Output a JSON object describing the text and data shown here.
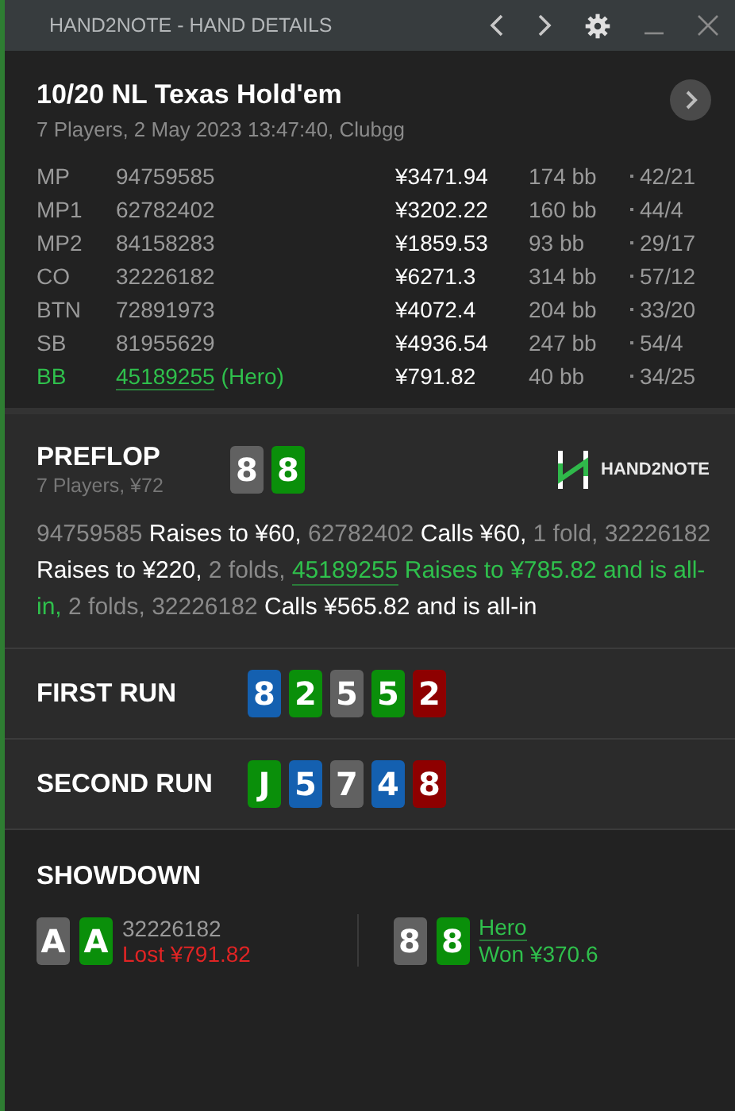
{
  "window": {
    "title": "HAND2NOTE - HAND DETAILS"
  },
  "header": {
    "title": "10/20 NL Texas Hold'em",
    "subtitle": "7 Players, 2 May 2023 13:47:40, Clubgg"
  },
  "players": [
    {
      "position": "MP",
      "name": "94759585",
      "hero": false,
      "stack": "¥3471.94",
      "bb": "174 bb",
      "stats": "42/21"
    },
    {
      "position": "MP1",
      "name": "62782402",
      "hero": false,
      "stack": "¥3202.22",
      "bb": "160 bb",
      "stats": "44/4"
    },
    {
      "position": "MP2",
      "name": "84158283",
      "hero": false,
      "stack": "¥1859.53",
      "bb": "93 bb",
      "stats": "29/17"
    },
    {
      "position": "CO",
      "name": "32226182",
      "hero": false,
      "stack": "¥6271.3",
      "bb": "314 bb",
      "stats": "57/12"
    },
    {
      "position": "BTN",
      "name": "72891973",
      "hero": false,
      "stack": "¥4072.4",
      "bb": "204 bb",
      "stats": "33/20"
    },
    {
      "position": "SB",
      "name": "81955629",
      "hero": false,
      "stack": "¥4936.54",
      "bb": "247 bb",
      "stats": "54/4"
    },
    {
      "position": "BB",
      "name": "45189255",
      "hero": true,
      "hero_tag": "(Hero)",
      "stack": "¥791.82",
      "bb": "40 bb",
      "stats": "34/25"
    }
  ],
  "preflop": {
    "title": "PREFLOP",
    "subtitle": "7 Players, ¥72",
    "logo": "HAND2NOTE",
    "cards": [
      {
        "rank": "8",
        "color": "#616161"
      },
      {
        "rank": "8",
        "color": "#0a8f0a"
      }
    ],
    "actions": [
      {
        "kind": "muted",
        "text": "94759585"
      },
      {
        "kind": "bright",
        "text": "Raises to ¥60,"
      },
      {
        "kind": "muted",
        "text": "62782402"
      },
      {
        "kind": "bright",
        "text": "Calls ¥60,"
      },
      {
        "kind": "muted",
        "text": "1 fold,"
      },
      {
        "kind": "muted",
        "text": "32226182"
      },
      {
        "kind": "bright",
        "text": "Raises to ¥220,"
      },
      {
        "kind": "muted",
        "text": "2 folds,"
      },
      {
        "kind": "link",
        "text": "45189255"
      },
      {
        "kind": "hero",
        "text": "Raises to ¥785.82 and is all-in,"
      },
      {
        "kind": "muted",
        "text": "2 folds,"
      },
      {
        "kind": "muted",
        "text": "32226182"
      },
      {
        "kind": "bright",
        "text": "Calls ¥565.82 and is all-in"
      }
    ]
  },
  "runs": [
    {
      "title": "FIRST RUN",
      "cards": [
        {
          "rank": "8",
          "color": "#1460b0"
        },
        {
          "rank": "2",
          "color": "#0a8f0a"
        },
        {
          "rank": "5",
          "color": "#616161"
        },
        {
          "rank": "5",
          "color": "#0a8f0a"
        },
        {
          "rank": "2",
          "color": "#8e0000"
        }
      ]
    },
    {
      "title": "SECOND RUN",
      "cards": [
        {
          "rank": "J",
          "color": "#0a8f0a"
        },
        {
          "rank": "5",
          "color": "#1460b0"
        },
        {
          "rank": "7",
          "color": "#616161"
        },
        {
          "rank": "4",
          "color": "#1460b0"
        },
        {
          "rank": "8",
          "color": "#8e0000"
        }
      ]
    }
  ],
  "showdown": {
    "title": "SHOWDOWN",
    "hands": [
      {
        "name": "32226182",
        "hero": false,
        "won": false,
        "result": "Lost ¥791.82",
        "cards": [
          {
            "rank": "A",
            "color": "#616161"
          },
          {
            "rank": "A",
            "color": "#0a8f0a"
          }
        ]
      },
      {
        "name": "Hero",
        "hero": true,
        "won": true,
        "result": "Won ¥370.6",
        "cards": [
          {
            "rank": "8",
            "color": "#616161"
          },
          {
            "rank": "8",
            "color": "#0a8f0a"
          }
        ]
      }
    ]
  }
}
